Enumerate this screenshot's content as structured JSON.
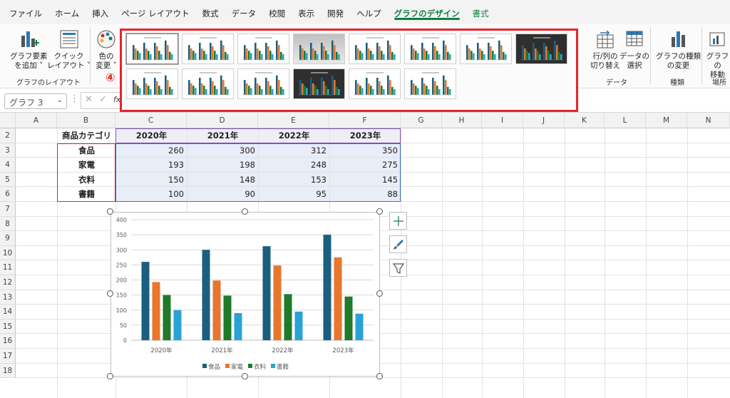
{
  "tabs": [
    "ファイル",
    "ホーム",
    "挿入",
    "ページ レイアウト",
    "数式",
    "データ",
    "校閲",
    "表示",
    "開発",
    "ヘルプ",
    "グラフのデザイン",
    "書式"
  ],
  "active_tab": "グラフのデザイン",
  "ribbon": {
    "add_element": [
      "グラフ要素",
      "を追加 ˅"
    ],
    "quick_layout": [
      "クイック",
      "レイアウト ˅"
    ],
    "group_layout": "グラフのレイアウト",
    "change_color": [
      "色の",
      "変更 ˅"
    ],
    "switch_row_col": [
      "行/列の",
      "切り替え"
    ],
    "select_data": [
      "データの",
      "選択"
    ],
    "group_data": "データ",
    "change_type": [
      "グラフの種類",
      "の変更"
    ],
    "group_type": "種類",
    "move_chart": [
      "グラフの",
      "移動"
    ],
    "group_location": "場所",
    "step_badge": "④"
  },
  "gallery": {
    "styles_count": 14,
    "selected": 1
  },
  "formula_bar": {
    "name_box": "グラフ 3",
    "fx": "fx"
  },
  "columns": [
    "A",
    "B",
    "C",
    "D",
    "E",
    "F",
    "G",
    "H",
    "I",
    "J",
    "K",
    "L",
    "M",
    "N"
  ],
  "rows": [
    "2",
    "3",
    "4",
    "5",
    "6",
    "7",
    "8",
    "9",
    "10",
    "11",
    "12",
    "13",
    "14",
    "15",
    "16",
    "17",
    "18"
  ],
  "table": {
    "corner": "商品カテゴリ",
    "years": [
      "2020年",
      "2021年",
      "2022年",
      "2023年"
    ],
    "rows": [
      {
        "label": "食品",
        "values": [
          "260",
          "300",
          "312",
          "350"
        ]
      },
      {
        "label": "家電",
        "values": [
          "193",
          "198",
          "248",
          "275"
        ]
      },
      {
        "label": "衣料",
        "values": [
          "150",
          "148",
          "153",
          "145"
        ]
      },
      {
        "label": "書籍",
        "values": [
          "100",
          "90",
          "95",
          "88"
        ]
      }
    ]
  },
  "chart_data": {
    "type": "bar",
    "categories": [
      "2020年",
      "2021年",
      "2022年",
      "2023年"
    ],
    "series": [
      {
        "name": "食品",
        "values": [
          260,
          300,
          312,
          350
        ],
        "color": "#1a5f7f"
      },
      {
        "name": "家電",
        "values": [
          193,
          198,
          248,
          275
        ],
        "color": "#e8762d"
      },
      {
        "name": "衣料",
        "values": [
          150,
          148,
          153,
          145
        ],
        "color": "#1f7a2a"
      },
      {
        "name": "書籍",
        "values": [
          100,
          90,
          95,
          88
        ],
        "color": "#29a3d6"
      }
    ],
    "yticks": [
      "0",
      "50",
      "100",
      "150",
      "200",
      "250",
      "300",
      "350",
      "400"
    ],
    "ylim": [
      0,
      400
    ],
    "grid": true,
    "legend": "bottom"
  }
}
